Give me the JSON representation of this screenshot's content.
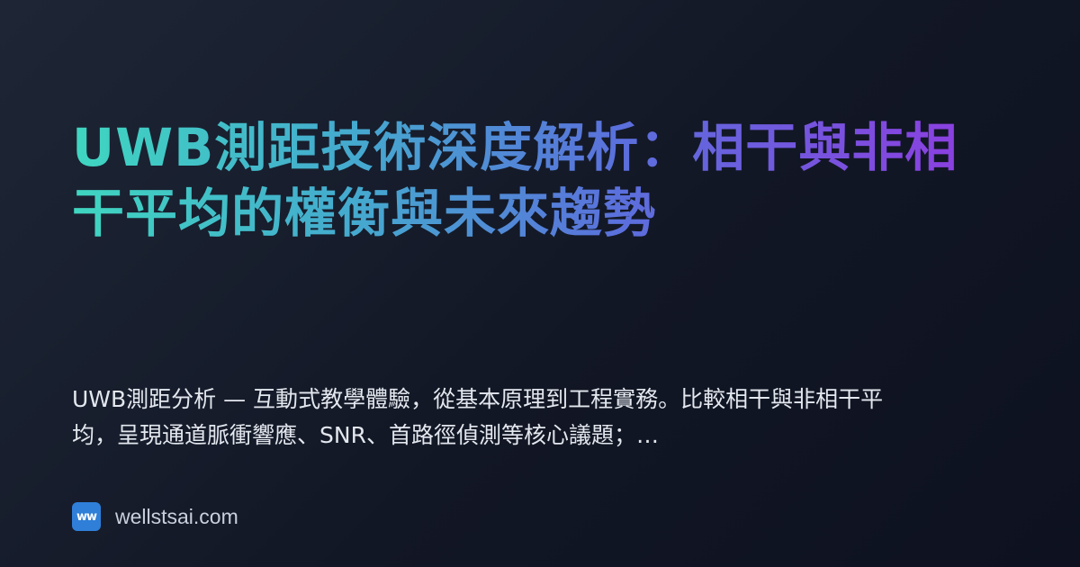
{
  "card": {
    "title": "UWB測距技術深度解析：相干與非相干平均的權衡與未來趨勢",
    "description": "UWB測距分析 — 互動式教學體驗，從基本原理到工程實務。比較相干與非相干平均，呈現通道脈衝響應、SNR、首路徑偵測等核心議題；…",
    "site": {
      "logo_text": "ww",
      "domain": "wellstsai.com"
    }
  },
  "colors": {
    "background": "#141a28",
    "title_gradient_start": "#3fd6c0",
    "title_gradient_mid": "#5b6fdc",
    "title_gradient_end": "#8b3fe0",
    "description_text": "#e3e7ee",
    "logo_background": "#2f7fd8",
    "domain_text": "#c9d0dc"
  }
}
